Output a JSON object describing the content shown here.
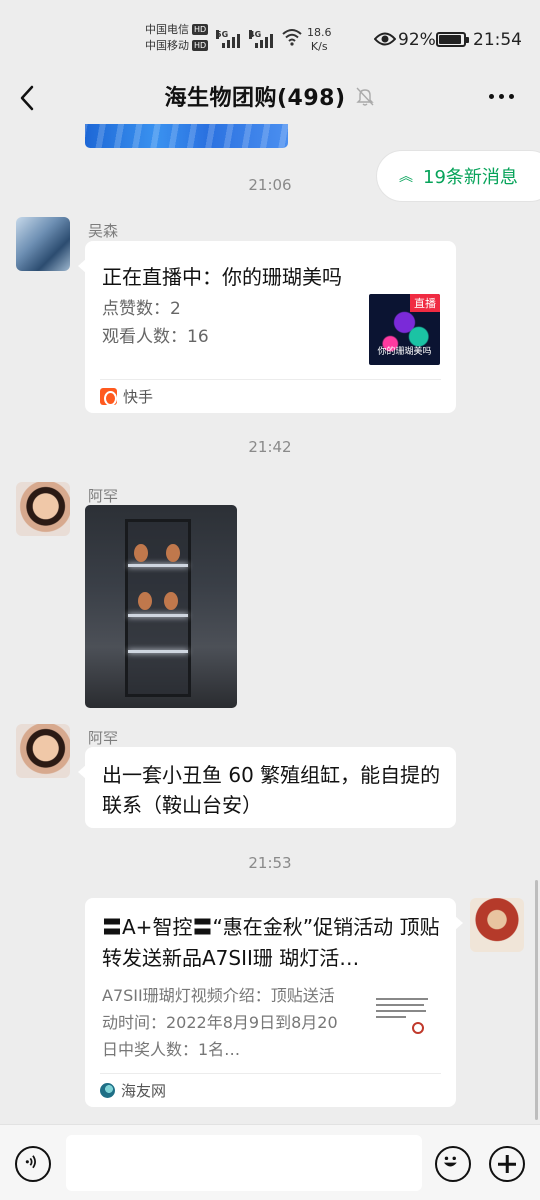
{
  "status_bar": {
    "carrier1": "中国电信",
    "carrier2": "中国移动",
    "hd_badge": "HD",
    "net1": "5G",
    "net2": "4G",
    "speed_value": "18.6",
    "speed_unit": "K/s",
    "battery_pct": "92%",
    "battery_level": 0.92,
    "time": "21:54"
  },
  "nav": {
    "title": "海生物团购(498)"
  },
  "new_messages": "19条新消息",
  "messages": {
    "t1": "21:06",
    "m1": {
      "sender": "吴森",
      "title": "正在直播中：你的珊瑚美吗",
      "likes": "点赞数：2",
      "viewers": "观看人数：16",
      "badge": "直播",
      "thumb_caption": "你的珊瑚美吗",
      "source": "快手"
    },
    "t2": "21:42",
    "m2": {
      "sender": "阿罕"
    },
    "m3": {
      "sender": "阿罕",
      "text": "出一套小丑鱼 60 繁殖组缸，能自提的联系（鞍山台安）"
    },
    "t3": "21:53",
    "m4": {
      "title": "〓A+智控〓“惠在金秋”促销活动 顶贴转发送新品A7SII珊 瑚灯活…",
      "desc": "A7SII珊瑚灯视频介绍：顶贴送活动时间：2022年8月9日到8月20日中奖人数：1名…",
      "source": "海友网"
    }
  }
}
